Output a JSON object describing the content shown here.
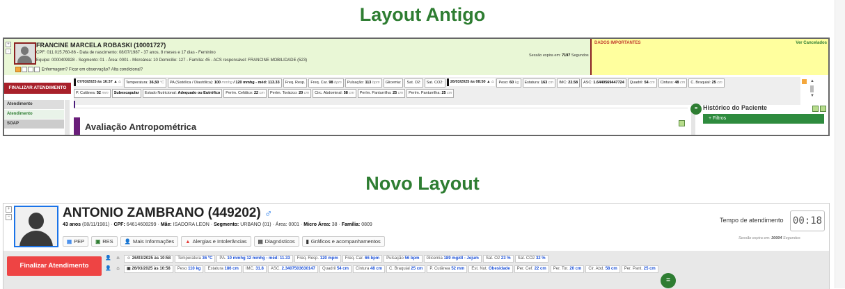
{
  "headings": {
    "old": "Layout Antigo",
    "new": "Novo Layout"
  },
  "old": {
    "ctrl_plus": "+",
    "ctrl_minus": "-",
    "name": "FRANCINE MARCELA ROBASKI (10001727)",
    "line1": "CPF: 011.015.760-86 - Data de nascimento: 08/07/1987 - 37 anos, 8 meses e 17 dias - Feminino",
    "line2": "Equipe: 0000409928 - Segmento: 01 - Área: 0001 - Microárea: 10 Domicílio: 127 - Família: 45 - ACS responsável: FRANCINE MOBILIDADE (523)",
    "line3": "Enfermagem?  Ficar em observação?  Alta condicional?",
    "session_label": "Sessão expira em:",
    "session_value": "7197",
    "session_unit": "Segundos",
    "dados_title": "DADOS IMPORTANTES",
    "dados_link": "Ver Cancelados",
    "finalizar": "FINALIZAR ATENDIMENTO",
    "vitals_row1": [
      {
        "kind": "date",
        "text": "07/03/2025 às 16:37"
      },
      {
        "label": "Temperatura:",
        "value": "36,50",
        "unit": "°C"
      },
      {
        "label": "PA (Sistólica / Diastólica):",
        "value": "100",
        "unit": "mmhg",
        "extra": "/ 120 mmhg - méd: 113.33"
      },
      {
        "label": "Freq. Resp.",
        "value": "",
        "unit": ""
      },
      {
        "label": "Freq. Car.",
        "value": "98",
        "unit": "bpm"
      },
      {
        "label": "Pulsação:",
        "value": "113",
        "unit": "bpm"
      },
      {
        "label": "Glicemia:",
        "value": "",
        "unit": ""
      },
      {
        "label": "Sat. O2:",
        "value": "",
        "unit": ""
      },
      {
        "label": "Sat. CO2:",
        "value": "",
        "unit": ""
      },
      {
        "kind": "date",
        "text": "26/03/2025 às 08:50"
      },
      {
        "label": "Peso:",
        "value": "60",
        "unit": "kg"
      },
      {
        "label": "Estatura:",
        "value": "163",
        "unit": "cm"
      },
      {
        "label": "IMC:",
        "value": "22.58",
        "unit": ""
      },
      {
        "label": "ASC:",
        "value": "1.6440569447724",
        "unit": ""
      },
      {
        "label": "Quadril:",
        "value": "54",
        "unit": "cm"
      },
      {
        "label": "Cintura:",
        "value": "48",
        "unit": "cm"
      },
      {
        "label": "C. Braquial:",
        "value": "25",
        "unit": "cm"
      }
    ],
    "vitals_row2": [
      {
        "label": "P. Cutânea:",
        "value": "52",
        "unit": "mm"
      },
      {
        "label": "",
        "value": "Subescapular",
        "unit": ""
      },
      {
        "label": "Estado Nutricional:",
        "value": "Adequado ou Eutrófico",
        "unit": ""
      },
      {
        "label": "Perím. Cefálico:",
        "value": "22",
        "unit": "cm"
      },
      {
        "label": "Perím. Torácico:",
        "value": "20",
        "unit": "cm"
      },
      {
        "label": "Circ. Abdominal:",
        "value": "58",
        "unit": "cm"
      },
      {
        "label": "Perím. Panturrilha:",
        "value": "25",
        "unit": "cm"
      },
      {
        "label": "Perím. Panturrilha:",
        "value": "25",
        "unit": "cm"
      }
    ],
    "nav": [
      "Atendimento",
      "Atendimento",
      "SOAP"
    ],
    "section_title": "Avaliação Antropométrica",
    "hist_button": "=",
    "hist_title": "Histórico do Paciente",
    "filtros": "+ Filtros"
  },
  "new": {
    "ctrl_plus": "+",
    "ctrl_minus": "−",
    "name": "ANTONIO ZAMBRANO",
    "id": "(449202)",
    "gender_symbol": "♂",
    "info": {
      "age": "43 anos",
      "dob": "(08/11/1981)",
      "cpf_label": "CPF:",
      "cpf": "64614608299",
      "mae_label": "Mãe:",
      "mae": "ISADORA LEON",
      "segmento_label": "Segmento:",
      "segmento": "URBANO (01)",
      "area_label": "Área:",
      "area": "0001",
      "micro_label": "Micro Área:",
      "micro": "38",
      "familia_label": "Família:",
      "familia": "0809"
    },
    "tabs": [
      {
        "icon": "doc-icon",
        "glyph": "▤",
        "color": "#1a73e8",
        "label": "PEP"
      },
      {
        "icon": "res-icon",
        "glyph": "▣",
        "color": "#2e7d32",
        "label": "RES"
      },
      {
        "icon": "person-icon",
        "glyph": "👤",
        "color": "#333333",
        "label": "Mais Informações"
      },
      {
        "icon": "warning-icon",
        "glyph": "▲",
        "color": "#e53935",
        "label": "Alergias e Intolerâncias"
      },
      {
        "icon": "file-icon",
        "glyph": "▤",
        "color": "#333333",
        "label": "Diagnósticos"
      },
      {
        "icon": "chart-icon",
        "glyph": "▮",
        "color": "#333333",
        "label": "Gráficos e acompanhamentos"
      }
    ],
    "tempo_label": "Tempo de atendimento",
    "tempo_value": "00:18",
    "session_label": "Sessão expira em:",
    "session_value": "30004",
    "session_unit": "Segundos",
    "finalizar": "Finalizar Atendimento",
    "row1": {
      "date": "26/03/2025 às 10:58",
      "items": [
        {
          "label": "Temperatura",
          "value": "36 ºC"
        },
        {
          "label": "PA.",
          "value": "10 mmhg 12 mmhg - méd: 11.33"
        },
        {
          "label": "Freq. Resp.",
          "value": "120 mpm"
        },
        {
          "label": "Freq. Car.",
          "value": "66 bpm"
        },
        {
          "label": "Pulsação",
          "value": "56 bpm"
        },
        {
          "label": "Glicemia",
          "value": "189 mg/dl - Jejum"
        },
        {
          "label": "Sat. O2",
          "value": "23 %"
        },
        {
          "label": "Sat. CO2",
          "value": "32 %"
        }
      ]
    },
    "row2": {
      "date": "26/03/2025 às 10:58",
      "items": [
        {
          "label": "Peso",
          "value": "110 kg"
        },
        {
          "label": "Estatura",
          "value": "186 cm"
        },
        {
          "label": "IMC.",
          "value": "31.8"
        },
        {
          "label": "ASC.",
          "value": "2.3407503630147"
        },
        {
          "label": "Quadril",
          "value": "54 cm"
        },
        {
          "label": "Cintura",
          "value": "48 cm"
        },
        {
          "label": "C. Braquial",
          "value": "25 cm"
        },
        {
          "label": "P. Cutânea",
          "value": "52 mm"
        },
        {
          "label": "Est. Nut.",
          "value": "Obesidade"
        },
        {
          "label": "Per. Cef.",
          "value": "22 cm"
        },
        {
          "label": "Per. Tor.",
          "value": "20 cm"
        },
        {
          "label": "Cir. Abd.",
          "value": "58 cm"
        },
        {
          "label": "Per. Pant.",
          "value": "25 cm"
        }
      ]
    },
    "circle_button": "="
  }
}
